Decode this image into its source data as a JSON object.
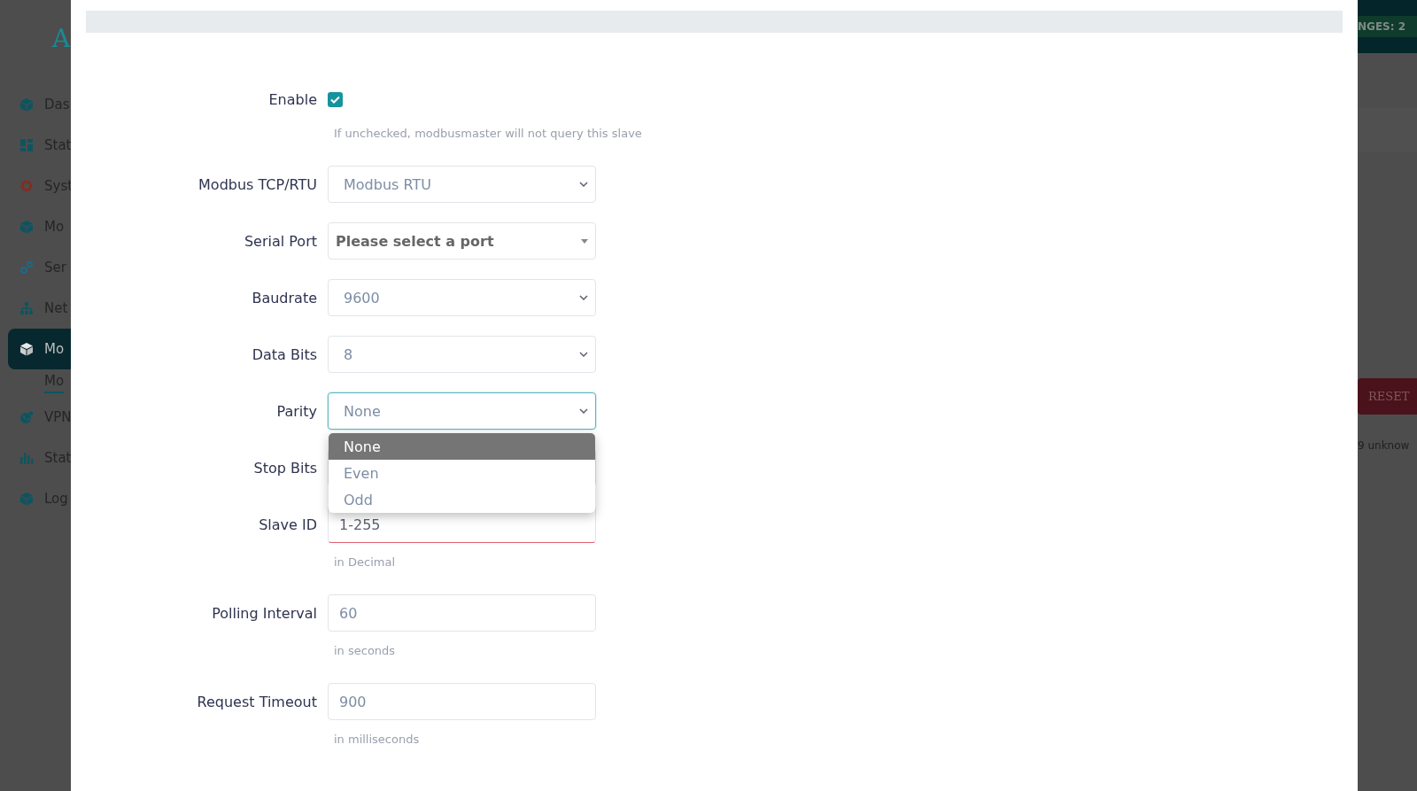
{
  "sidebar": {
    "logo": "A",
    "items": [
      {
        "label": "Das",
        "selected": false
      },
      {
        "label": "Stat",
        "selected": false
      },
      {
        "label": "Syst",
        "selected": false
      },
      {
        "label": "Mo",
        "selected": false
      },
      {
        "label": "Ser",
        "selected": false
      },
      {
        "label": "Net",
        "selected": false
      },
      {
        "label": "Mo",
        "selected": true,
        "children": [
          {
            "label": "Mo",
            "selected": true
          }
        ]
      },
      {
        "label": "VPN",
        "selected": false
      },
      {
        "label": "Stat",
        "selected": false
      },
      {
        "label": "Log",
        "selected": false
      }
    ]
  },
  "form": {
    "fields": [
      {
        "kind": "checkbox",
        "label": "Enable",
        "checked": true,
        "help": "If unchecked, modbusmaster will not query this slave"
      },
      {
        "kind": "select",
        "label": "Modbus TCP/RTU",
        "value": "Modbus RTU",
        "focused": false
      },
      {
        "kind": "combo",
        "label": "Serial Port",
        "placeholder": "Please select a port"
      },
      {
        "kind": "select",
        "label": "Baudrate",
        "value": "9600",
        "focused": false
      },
      {
        "kind": "select",
        "label": "Data Bits",
        "value": "8",
        "focused": false
      },
      {
        "kind": "select",
        "label": "Parity",
        "value": "None",
        "focused": true,
        "options": [
          {
            "label": "None",
            "selected": true
          },
          {
            "label": "Even",
            "selected": false
          },
          {
            "label": "Odd",
            "selected": false
          }
        ]
      },
      {
        "kind": "covered",
        "label": "Stop Bits"
      },
      {
        "kind": "input",
        "label": "Slave ID",
        "placeholder": "1-255",
        "invalid": true,
        "help": "in Decimal"
      },
      {
        "kind": "input",
        "label": "Polling Interval",
        "value": "60",
        "invalid": false,
        "help": "in seconds"
      },
      {
        "kind": "input",
        "label": "Request Timeout",
        "value": "900",
        "invalid": false,
        "help": "in milliseconds"
      }
    ]
  },
  "right_panel": {
    "changes_badge": "NGES: 2",
    "reset_button": "RESET",
    "status_text": "9 unknow"
  }
}
